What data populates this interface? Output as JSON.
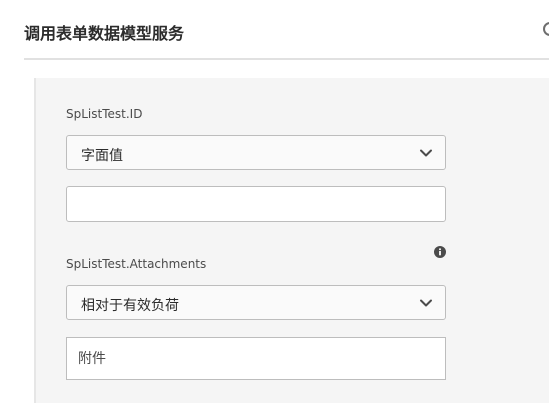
{
  "header": {
    "title": "调用表单数据模型服务"
  },
  "fields": [
    {
      "label": "SpListTest.ID",
      "mapping_type": "字面值",
      "value": ""
    },
    {
      "label": "SpListTest.Attachments",
      "info_icon": "info-icon",
      "mapping_type": "相对于有效负荷",
      "value_placeholder": "附件"
    }
  ],
  "colors": {
    "panel_background": "#f5f5f5",
    "border": "#bdbdbd",
    "text": "#2c2c2c"
  }
}
